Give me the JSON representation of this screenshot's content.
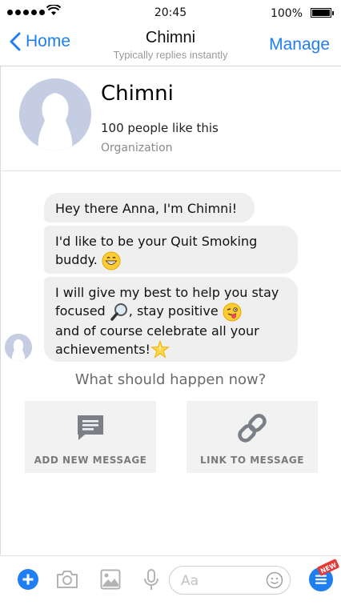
{
  "status_bar": {
    "time": "20:45",
    "battery": "100%"
  },
  "nav": {
    "back_label": "Home",
    "title": "Chimni",
    "subtitle": "Typically replies instantly",
    "manage_label": "Manage"
  },
  "profile": {
    "name": "Chimni",
    "likes": "100 people like this",
    "type": "Organization"
  },
  "messages": [
    {
      "text": "Hey there Anna, I'm Chimni!"
    },
    {
      "line1": "I'd like to be your Quit Smoking",
      "line2": "buddy."
    },
    {
      "line1": "I will give my best to help you stay",
      "line2a": "focused ",
      "line2b": ", stay positive ",
      "line3": "and of course celebrate all your",
      "line4": "achievements!"
    }
  ],
  "prompt": "What should happen now?",
  "actions": [
    {
      "label": "ADD NEW MESSAGE",
      "icon": "message-icon"
    },
    {
      "label": "LINK TO MESSAGE",
      "icon": "link-icon"
    }
  ],
  "composer": {
    "placeholder": "Aa",
    "badge": "NEW"
  },
  "colors": {
    "accent": "#1f7ff0",
    "bubble": "#efefef",
    "action_bg": "#f2f2f2"
  }
}
